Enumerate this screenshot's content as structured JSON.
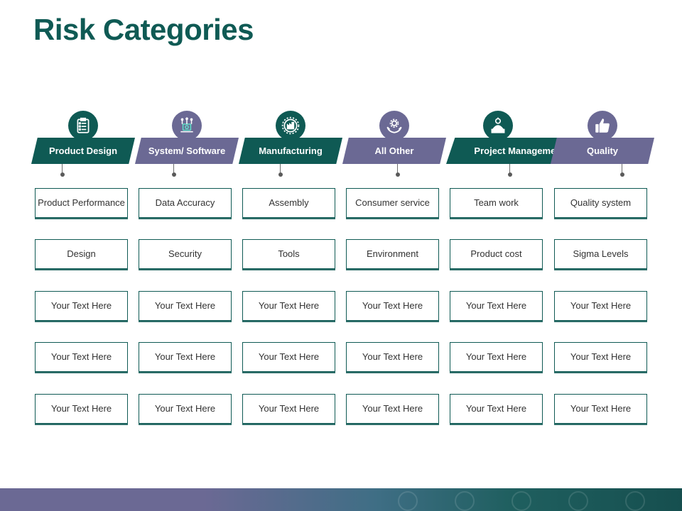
{
  "title": "Risk Categories",
  "colors": {
    "green": "#0f5a54",
    "purple": "#6b6994"
  },
  "columns": [
    {
      "heading": "Product Design",
      "icon": "checklist-icon",
      "color": "#0f5a54",
      "cells": [
        "Product Performance",
        "Design",
        "Your Text Here",
        "Your Text Here",
        "Your Text Here"
      ]
    },
    {
      "heading": "System/ Software",
      "icon": "circuit-icon",
      "color": "#6b6994",
      "cells": [
        "Data Accuracy",
        "Security",
        "Your Text Here",
        "Your Text Here",
        "Your Text Here"
      ]
    },
    {
      "heading": "Manufacturing",
      "icon": "gear-factory-icon",
      "color": "#0f5a54",
      "cells": [
        "Assembly",
        "Tools",
        "Your Text Here",
        "Your Text Here",
        "Your Text Here"
      ]
    },
    {
      "heading": "All Other",
      "icon": "hands-gear-icon",
      "color": "#6b6994",
      "cells": [
        "Consumer service",
        "Environment",
        "Your Text Here",
        "Your Text Here",
        "Your Text Here"
      ]
    },
    {
      "heading": "Project Management",
      "icon": "manager-icon",
      "color": "#0f5a54",
      "cells": [
        "Team work",
        "Product cost",
        "Your Text Here",
        "Your Text Here",
        "Your Text Here"
      ]
    },
    {
      "heading": "Quality",
      "icon": "thumbs-up-icon",
      "color": "#6b6994",
      "cells": [
        "Quality system",
        "Sigma Levels",
        "Your Text Here",
        "Your Text Here",
        "Your Text Here"
      ]
    }
  ]
}
